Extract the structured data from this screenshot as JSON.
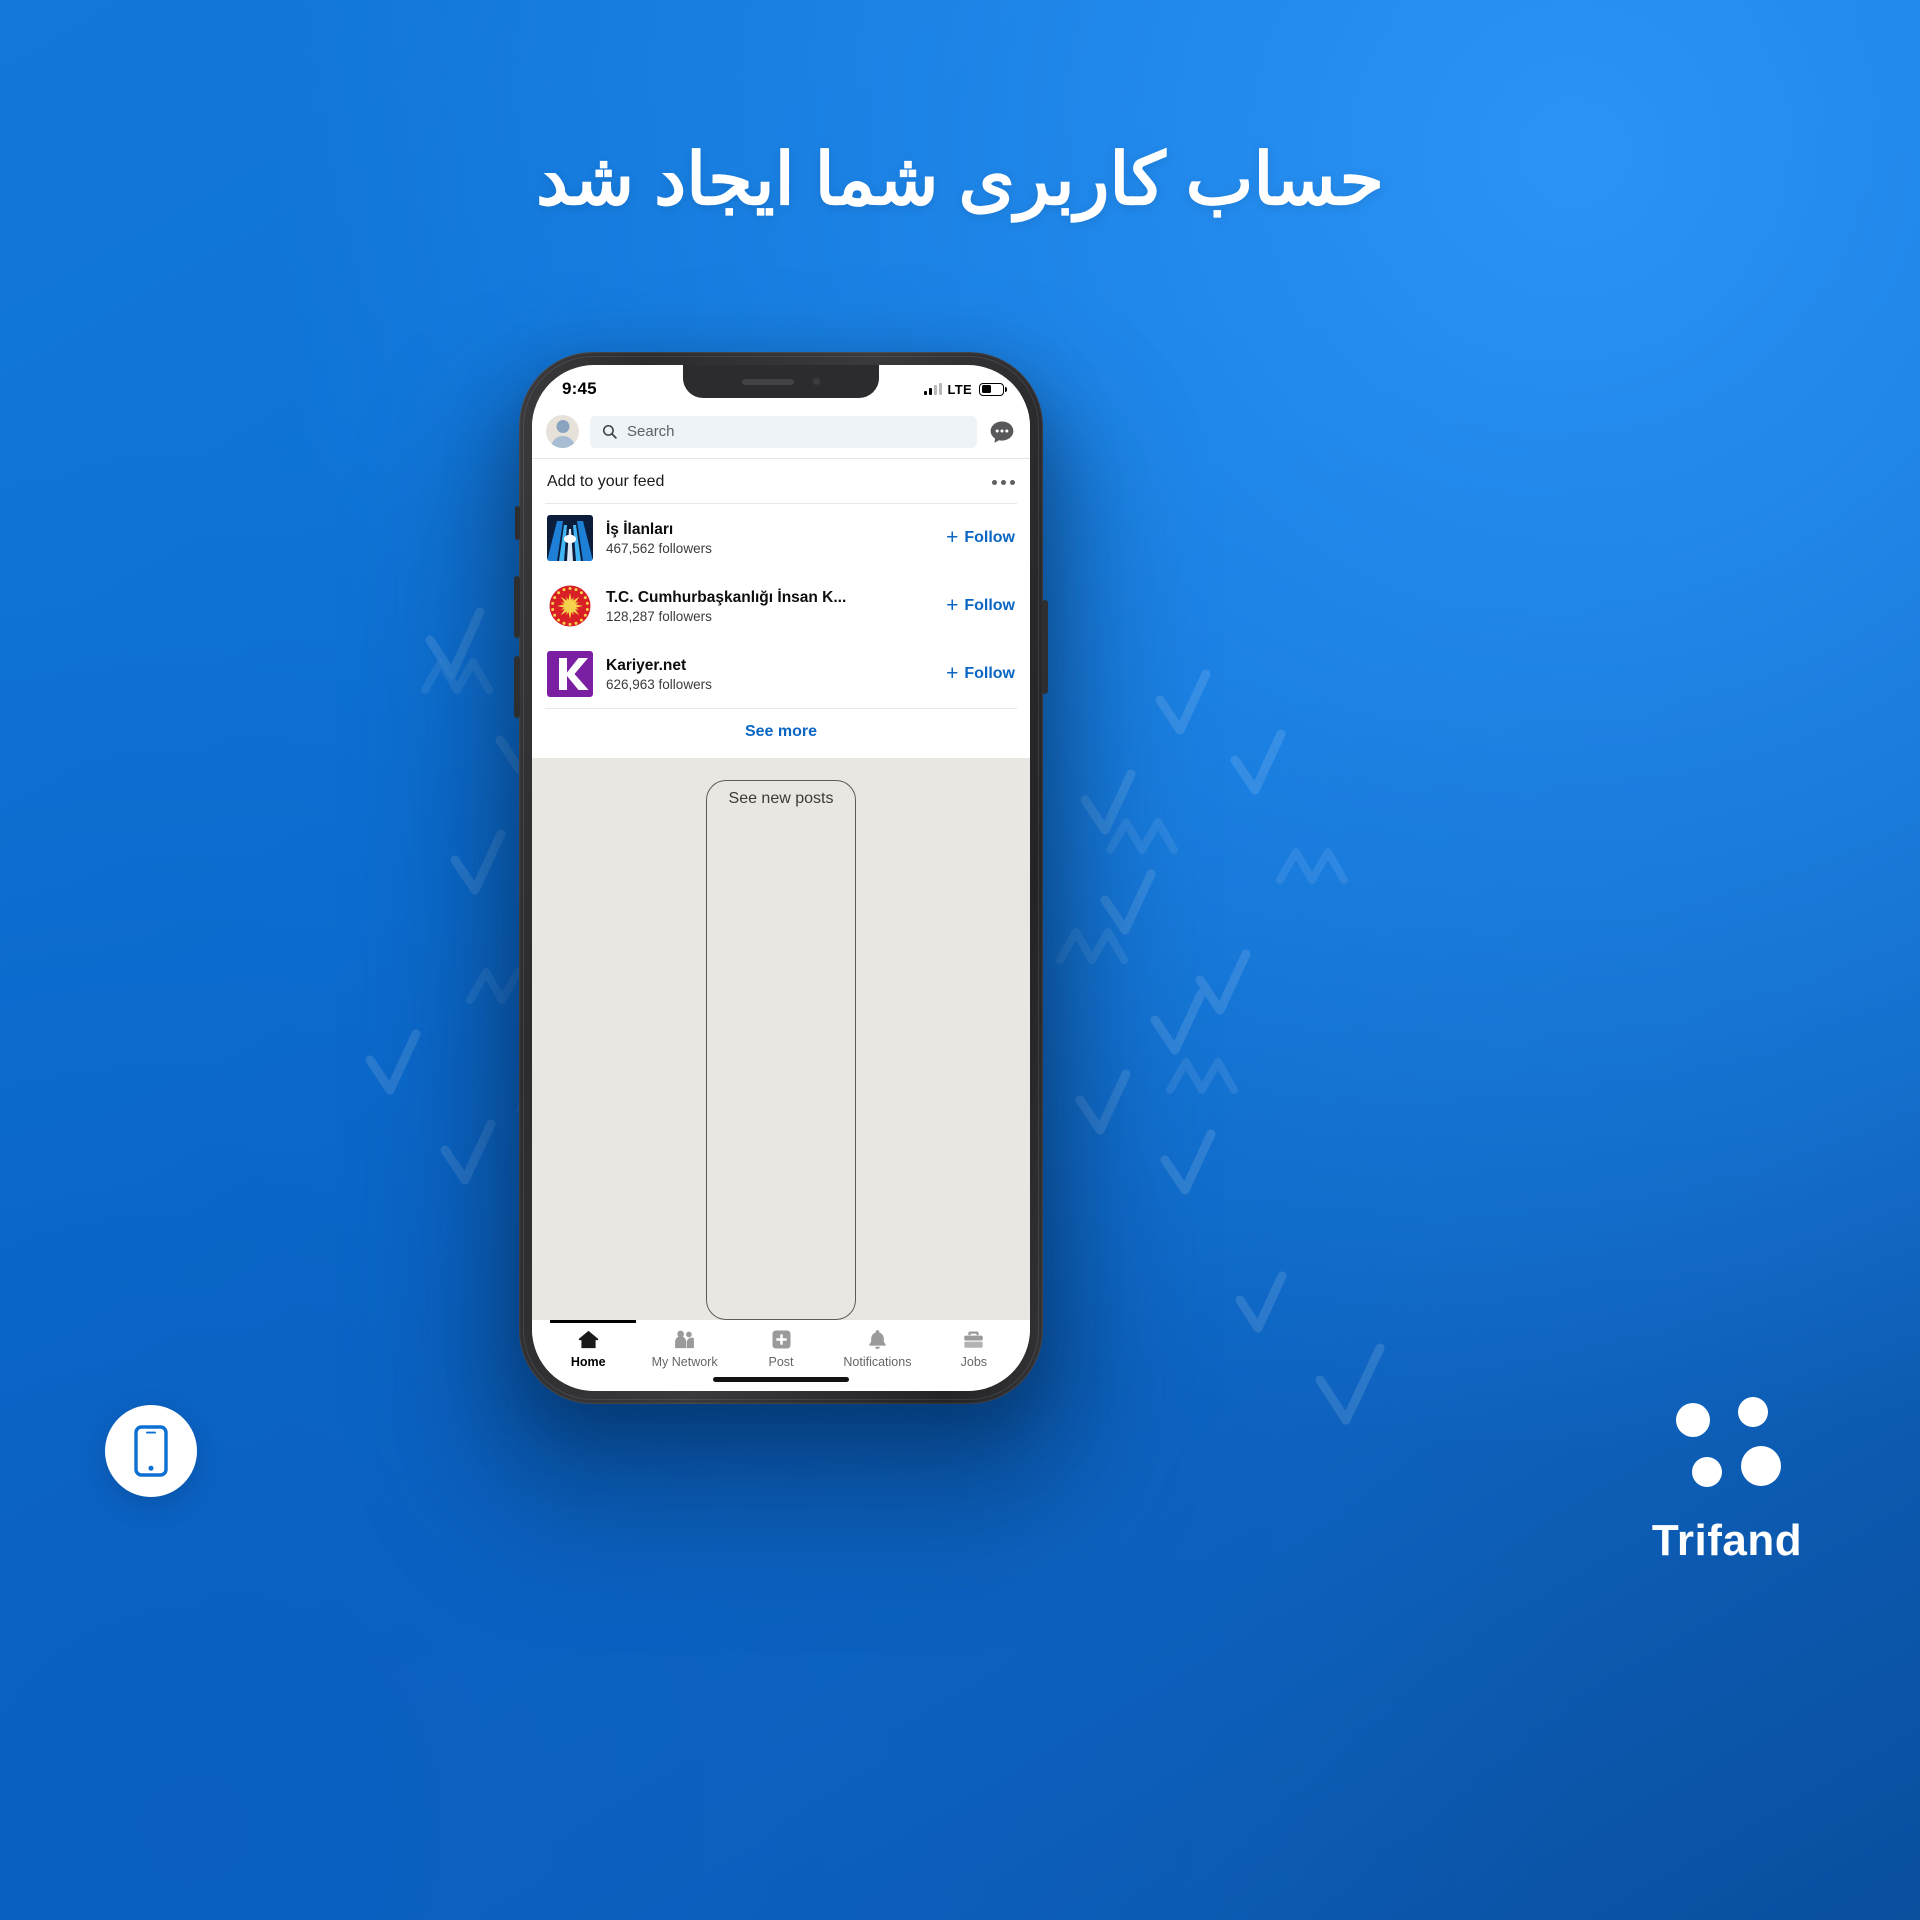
{
  "headline": "حساب کاربری شما ایجاد شد",
  "colors": {
    "background_start": "#1277d8",
    "background_end": "#0a4e9e",
    "accent_link": "#0a66c2",
    "white": "#ffffff",
    "feed_body": "#e9e7e1"
  },
  "phone": {
    "status_bar": {
      "time": "9:45",
      "network_label": "LTE",
      "signal_icon": "signal-bars-icon",
      "battery_icon": "battery-icon"
    },
    "top_bar": {
      "avatar_icon": "avatar-icon",
      "search_placeholder": "Search",
      "search_icon": "search-icon",
      "messaging_icon": "messaging-icon"
    },
    "feed_card": {
      "title": "Add to your feed",
      "overflow_icon": "more-options-icon",
      "items": [
        {
          "name": "İş İlanları",
          "followers": "467,562 followers",
          "follow_label": "Follow",
          "logo_icon": "skyscraper-photo-icon"
        },
        {
          "name": "T.C. Cumhurbaşkanlığı İnsan K...",
          "followers": "128,287 followers",
          "follow_label": "Follow",
          "logo_icon": "turkish-presidency-seal-icon"
        },
        {
          "name": "Kariyer.net",
          "followers": "626,963 followers",
          "follow_label": "Follow",
          "logo_icon": "kariyer-k-logo-icon"
        }
      ],
      "see_more_label": "See more"
    },
    "feed_body": {
      "new_posts_label": "See new posts"
    },
    "bottom_nav": [
      {
        "label": "Home",
        "icon": "home-icon",
        "active": true
      },
      {
        "label": "My Network",
        "icon": "people-icon",
        "active": false
      },
      {
        "label": "Post",
        "icon": "plus-square-icon",
        "active": false
      },
      {
        "label": "Notifications",
        "icon": "bell-icon",
        "active": false
      },
      {
        "label": "Jobs",
        "icon": "briefcase-icon",
        "active": false
      }
    ]
  },
  "badges": {
    "mobile_badge_icon": "mobile-phone-icon"
  },
  "brand": {
    "name": "Trifand",
    "logo_icon": "trifand-dots-logo-icon"
  }
}
